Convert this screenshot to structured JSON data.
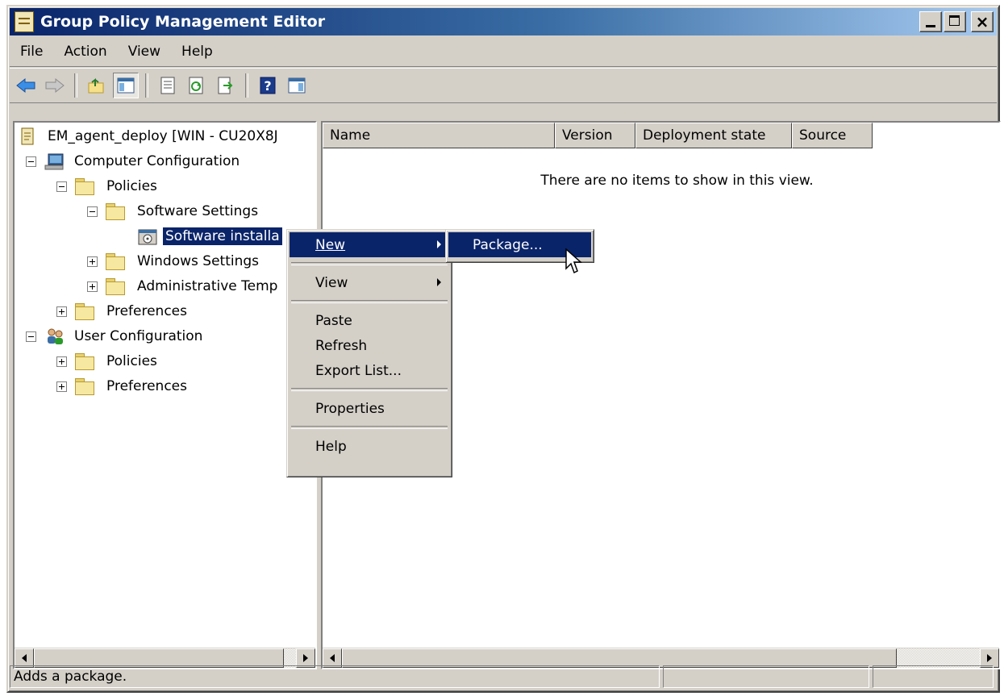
{
  "window": {
    "title": "Group Policy Management Editor",
    "close_glyph": "×"
  },
  "menubar": [
    "File",
    "Action",
    "View",
    "Help"
  ],
  "toolbar": {
    "icons": [
      "back-arrow-icon",
      "forward-arrow-icon",
      "up-folder-icon",
      "show-hide-tree-icon",
      "properties-icon",
      "refresh-icon",
      "export-list-icon",
      "help-icon",
      "show-hide-action-pane-icon"
    ]
  },
  "tree": {
    "root": "EM_agent_deploy [WIN - CU20X8J",
    "computer_config": "Computer Configuration",
    "policies": "Policies",
    "software_settings": "Software Settings",
    "software_installation": "Software installa",
    "windows_settings": "Windows Settings",
    "admin_templates": "Administrative Temp",
    "preferences": "Preferences",
    "user_config": "User Configuration",
    "user_policies": "Policies",
    "user_preferences": "Preferences"
  },
  "list": {
    "columns": [
      "Name",
      "Version",
      "Deployment state",
      "Source"
    ],
    "empty_message": "There are no items to show in this view."
  },
  "context_menu": {
    "new": "New",
    "view": "View",
    "paste": "Paste",
    "refresh": "Refresh",
    "export_list": "Export List...",
    "properties": "Properties",
    "help": "Help"
  },
  "submenu": {
    "package": "Package..."
  },
  "statusbar": {
    "text": "Adds a package."
  },
  "colors": {
    "titlebar": "#0a246a",
    "highlight": "#0a246a",
    "face": "#d4d0c8"
  }
}
